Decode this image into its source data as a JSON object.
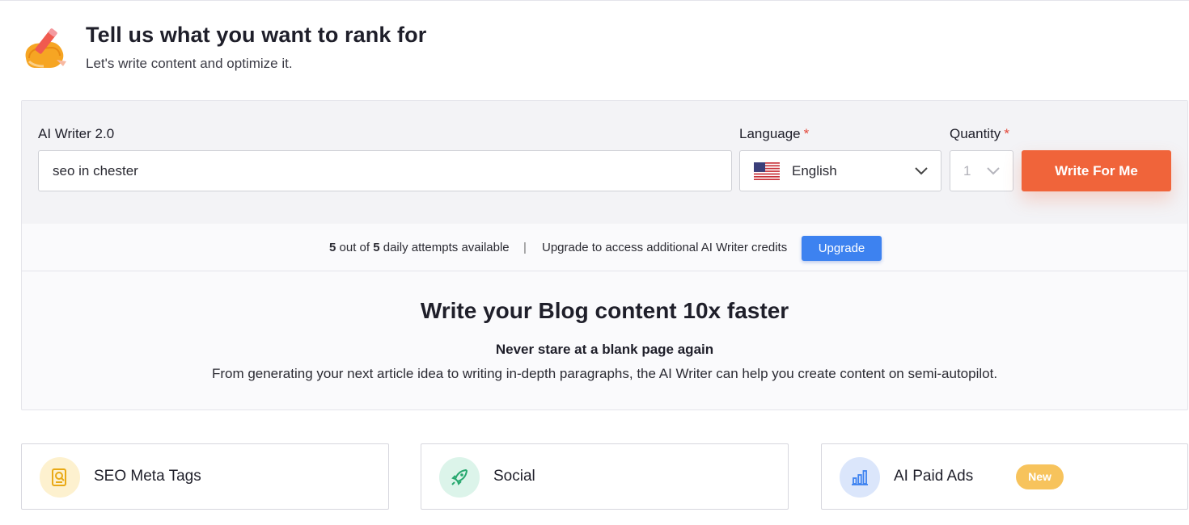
{
  "header": {
    "title": "Tell us what you want to rank for",
    "subtitle": "Let's write content and optimize it.",
    "icon": "writing-hand-icon"
  },
  "form": {
    "writer_label": "AI Writer 2.0",
    "keyword_value": "seo in chester",
    "language_label": "Language",
    "language_required": "*",
    "language_value": "English",
    "language_icon": "us-flag-icon",
    "quantity_label": "Quantity",
    "quantity_required": "*",
    "quantity_value": "1",
    "submit_label": "Write For Me"
  },
  "attempts": {
    "used": "5",
    "out_of_text": "out of",
    "total": "5",
    "suffix": "daily attempts available",
    "separator": "|",
    "upgrade_text": "Upgrade to access additional AI Writer credits",
    "upgrade_button": "Upgrade"
  },
  "promo": {
    "title": "Write your Blog content 10x faster",
    "subtitle": "Never stare at a blank page again",
    "description": "From generating your next article idea to writing in-depth paragraphs, the AI Writer can help you create content on semi-autopilot."
  },
  "tools": [
    {
      "label": "SEO Meta Tags",
      "icon": "seo-meta-tags-icon"
    },
    {
      "label": "Social",
      "icon": "rocket-icon"
    },
    {
      "label": "AI Paid Ads",
      "icon": "bar-chart-icon",
      "badge": "New"
    }
  ],
  "colors": {
    "accent": "#f0643a",
    "upgrade": "#3d82f0",
    "badge": "#f7c35c",
    "required": "#e2483a"
  }
}
